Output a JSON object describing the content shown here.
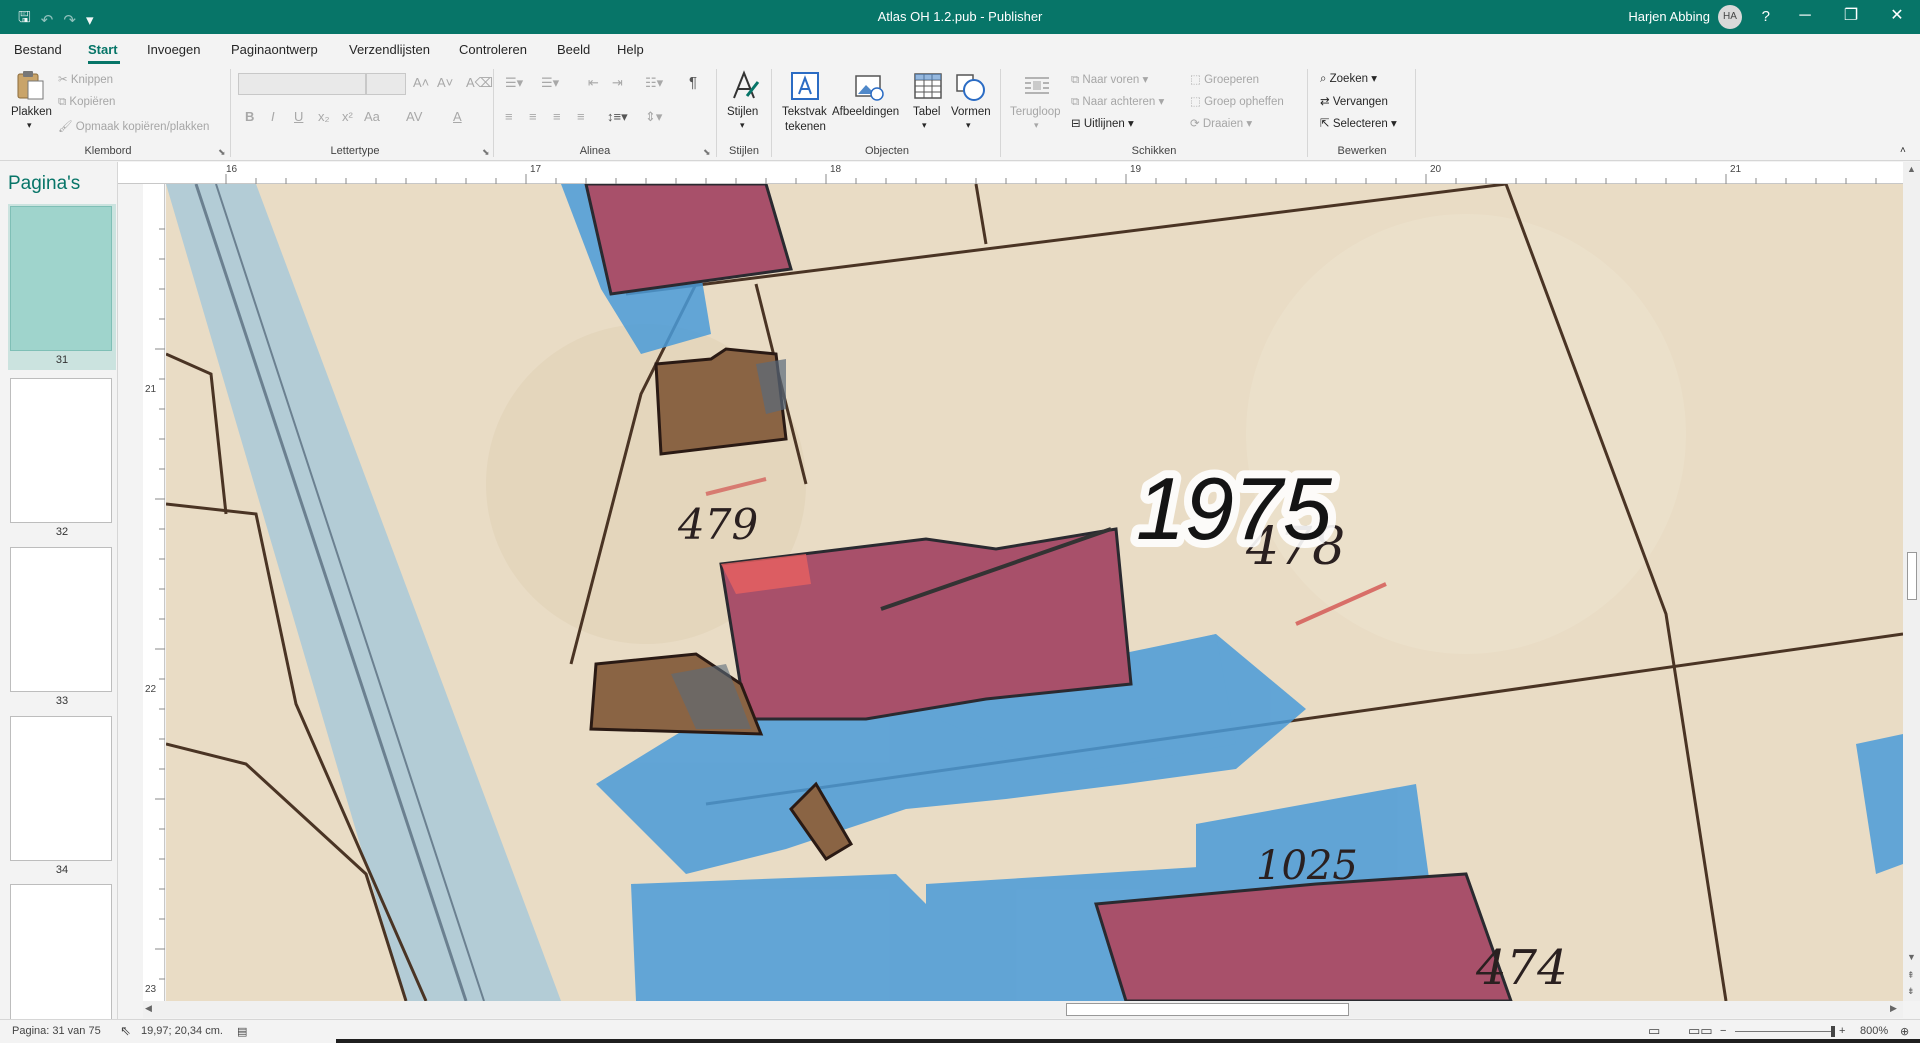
{
  "window": {
    "title": "Atlas OH 1.2.pub  -  Publisher",
    "user_name": "Harjen Abbing",
    "user_initials": "HA",
    "help": "?",
    "minimize": "─",
    "restore": "❐",
    "close": "✕"
  },
  "quick_access": {
    "save": "🖫",
    "undo": "↶",
    "redo": "↷",
    "customize": "▾"
  },
  "menu": {
    "tabs": [
      "Bestand",
      "Start",
      "Invoegen",
      "Paginaontwerp",
      "Verzendlijsten",
      "Controleren",
      "Beeld",
      "Help"
    ],
    "active": "Start"
  },
  "ribbon": {
    "klembord": {
      "label": "Klembord",
      "paste": "Plakken",
      "cut": "Knippen",
      "copy": "Kopiëren",
      "format_painter": "Opmaak kopiëren/plakken"
    },
    "lettertype": {
      "label": "Lettertype",
      "bold": "B",
      "italic": "I",
      "underline": "U",
      "subscript": "x₂",
      "superscript": "x²",
      "case": "Aa",
      "spacing": "AV",
      "font_color": "A"
    },
    "alinea": {
      "label": "Alinea",
      "pilcrow": "¶"
    },
    "stijlen": {
      "label": "Stijlen",
      "styles": "Stijlen"
    },
    "objecten": {
      "label": "Objecten",
      "textbox_line1": "Tekstvak",
      "textbox_line2": "tekenen",
      "pictures": "Afbeeldingen",
      "table": "Tabel",
      "shapes": "Vormen"
    },
    "schikken": {
      "label": "Schikken",
      "wrap": "Terugloop",
      "bring_forward": "Naar voren",
      "send_backward": "Naar achteren",
      "align": "Uitlijnen",
      "group": "Groeperen",
      "ungroup": "Groep opheffen",
      "rotate": "Draaien"
    },
    "bewerken": {
      "label": "Bewerken",
      "find": "Zoeken",
      "replace": "Vervangen",
      "select": "Selecteren"
    }
  },
  "pages_pane": {
    "title": "Pagina's",
    "pages": [
      "31",
      "32",
      "33",
      "34",
      ""
    ],
    "selected": "31"
  },
  "rulers": {
    "horizontal": [
      "16",
      "17",
      "18",
      "19",
      "20",
      "21"
    ],
    "vertical": [
      "21",
      "22",
      "23"
    ]
  },
  "canvas": {
    "year_label": "1975",
    "map_numbers": [
      "479",
      "478",
      "1025",
      "474"
    ],
    "colors": {
      "paper": "#e9dcc5",
      "building_red": "#a8506a",
      "water_blue": "#4a9bd8",
      "old_building": "#8a6444",
      "road": "#a9c9d8"
    }
  },
  "status": {
    "page": "Pagina: 31 van 75",
    "position": "19,97; 20,34 cm.",
    "zoom": "800%"
  }
}
